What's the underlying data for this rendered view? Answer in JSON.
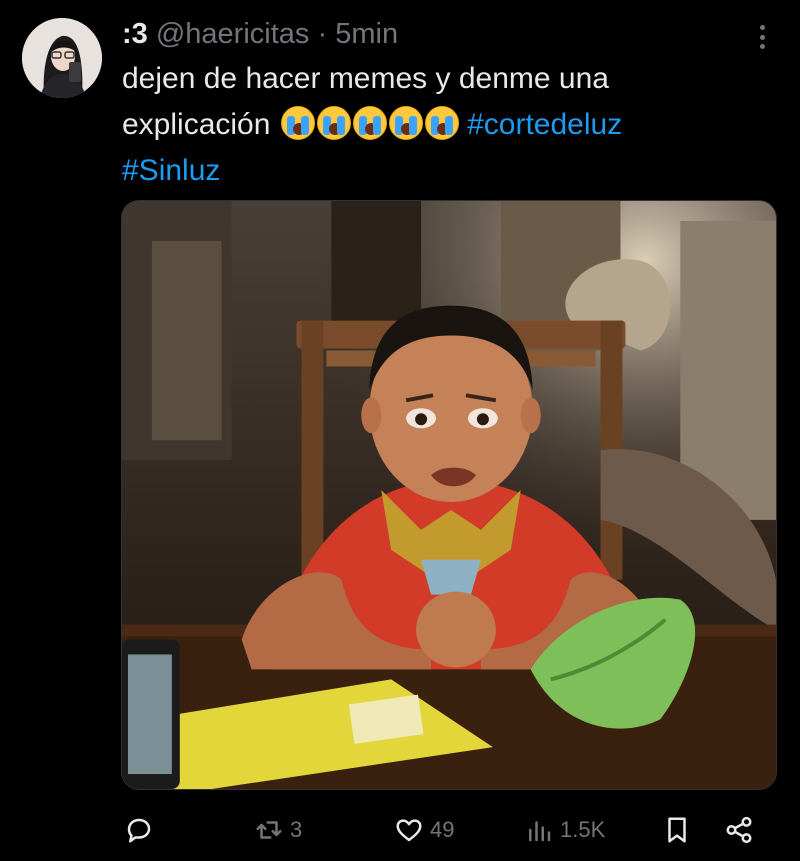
{
  "tweet": {
    "display_name": ":3",
    "handle": "@haericitas",
    "separator": "·",
    "time": "5min",
    "text_line1": "dejen de hacer memes y denme una",
    "text_line2_prefix": "explicación",
    "hashtag1": "#cortedeluz",
    "hashtag2": "#Sinluz",
    "emoji_name": "loudly-crying-face",
    "emoji_count": 5
  },
  "actions": {
    "replies": "",
    "retweets": "3",
    "likes": "49",
    "views": "1.5K"
  },
  "colors": {
    "background": "#000000",
    "text": "#e7e9ea",
    "muted": "#71767b",
    "link": "#1d9bf0"
  },
  "icons": [
    "more-icon",
    "reply-icon",
    "retweet-icon",
    "like-icon",
    "views-icon",
    "bookmark-icon",
    "share-icon"
  ]
}
